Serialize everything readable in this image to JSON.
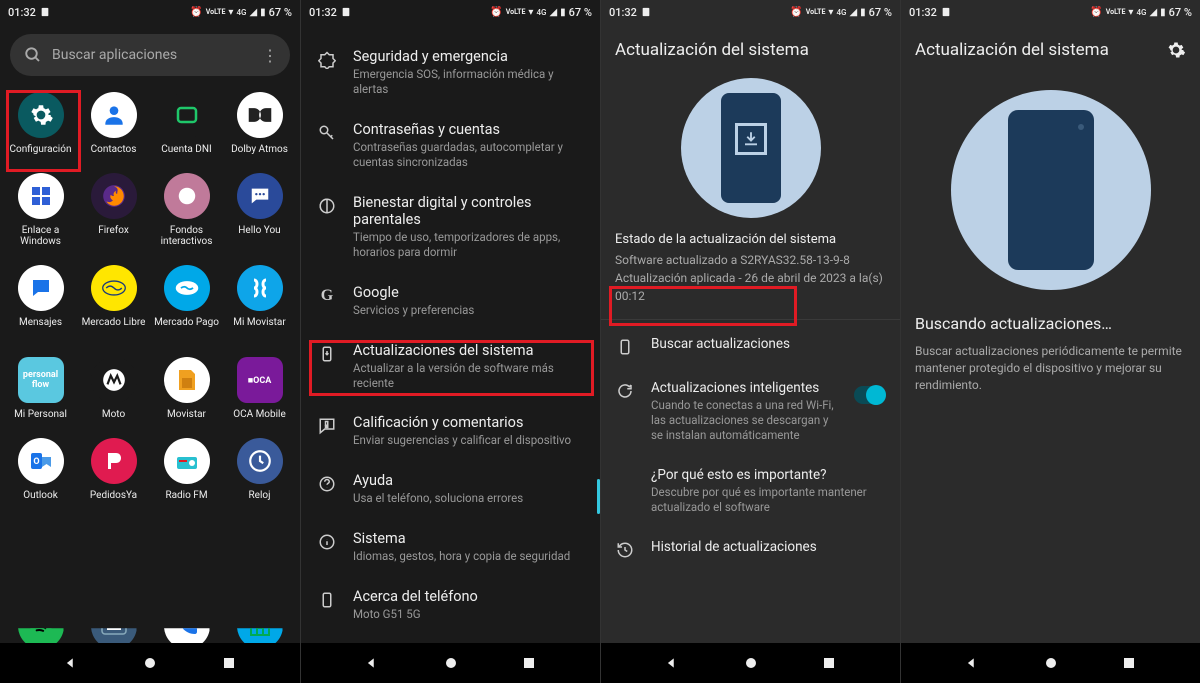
{
  "status": {
    "time": "01:32",
    "battery": "67 %"
  },
  "panel1": {
    "search_placeholder": "Buscar aplicaciones",
    "apps": [
      {
        "label": "Configuración",
        "bg": "#0a5a60",
        "fg": "#fff",
        "glyph": "gear"
      },
      {
        "label": "Contactos",
        "bg": "#ffffff",
        "fg": "#1a73e8",
        "glyph": "person"
      },
      {
        "label": "Cuenta DNI",
        "bg": "#1a1a1a",
        "fg": "#1fc76a",
        "glyph": "dni"
      },
      {
        "label": "Dolby Atmos",
        "bg": "#ffffff",
        "fg": "#222",
        "glyph": "dolby"
      },
      {
        "label": "Enlace a Windows",
        "bg": "#ffffff",
        "fg": "#2e5fd6",
        "glyph": "win",
        "two": true
      },
      {
        "label": "Firefox",
        "bg": "#2a1a3a",
        "fg": "#ff8a00",
        "glyph": "firefox"
      },
      {
        "label": "Fondos interactivos",
        "bg": "#c07a9a",
        "fg": "#fff",
        "glyph": "wall",
        "two": true
      },
      {
        "label": "Hello You",
        "bg": "#2a4a9a",
        "fg": "#fff",
        "glyph": "chat"
      },
      {
        "label": "Mensajes",
        "bg": "#ffffff",
        "fg": "#1a73e8",
        "glyph": "msg"
      },
      {
        "label": "Mercado Libre",
        "bg": "#ffe600",
        "fg": "#1a3a7a",
        "glyph": "ml",
        "two": true
      },
      {
        "label": "Mercado Pago",
        "bg": "#00a8e8",
        "fg": "#fff",
        "glyph": "mp",
        "two": true
      },
      {
        "label": "Mi Movistar",
        "bg": "#0ea5e9",
        "fg": "#fff",
        "glyph": "movi"
      },
      {
        "label": "Mi Personal",
        "bg": "#5ac8e0",
        "fg": "#fff",
        "glyph": "pers",
        "sq": true
      },
      {
        "label": "Moto",
        "bg": "#1a1a1a",
        "fg": "#fff",
        "glyph": "moto"
      },
      {
        "label": "Movistar",
        "bg": "#ffffff",
        "fg": "#0ea5e9",
        "glyph": "sim"
      },
      {
        "label": "OCA Mobile",
        "bg": "#7a1a9a",
        "fg": "#fff",
        "glyph": "oca",
        "sq": true
      },
      {
        "label": "Outlook",
        "bg": "#ffffff",
        "fg": "#1a73e8",
        "glyph": "out"
      },
      {
        "label": "PedidosYa",
        "bg": "#e01b50",
        "fg": "#fff",
        "glyph": "py"
      },
      {
        "label": "Radio FM",
        "bg": "#ffffff",
        "fg": "#e01b24",
        "glyph": "radio"
      },
      {
        "label": "Reloj",
        "bg": "#3a5a9a",
        "fg": "#fff",
        "glyph": "clock"
      }
    ],
    "bottom_apps": [
      {
        "bg": "#1db954",
        "glyph": "spotify"
      },
      {
        "bg": "#3a5a7a",
        "glyph": "kbd"
      },
      {
        "bg": "#ffffff",
        "glyph": "phone",
        "fg": "#1a73e8"
      },
      {
        "bg": "#00a8e8",
        "glyph": "home"
      }
    ]
  },
  "panel2": {
    "items": [
      {
        "icon": "medical",
        "title": "Seguridad y emergencia",
        "sub": "Emergencia SOS, información médica y alertas"
      },
      {
        "icon": "key",
        "title": "Contraseñas y cuentas",
        "sub": "Contraseñas guardadas, autocompletar y cuentas sincronizadas"
      },
      {
        "icon": "wellbeing",
        "title": "Bienestar digital y controles parentales",
        "sub": "Tiempo de uso, temporizadores de apps, horarios para dormir"
      },
      {
        "icon": "google",
        "title": "Google",
        "sub": "Servicios y preferencias"
      },
      {
        "icon": "phone-update",
        "title": "Actualizaciones del sistema",
        "sub": "Actualizar a la versión de software más reciente"
      },
      {
        "icon": "feedback",
        "title": "Calificación y comentarios",
        "sub": "Enviar sugerencias y calificar el dispositivo"
      },
      {
        "icon": "help",
        "title": "Ayuda",
        "sub": "Usa el teléfono, soluciona errores"
      },
      {
        "icon": "info",
        "title": "Sistema",
        "sub": "Idiomas, gestos, hora y copia de seguridad"
      },
      {
        "icon": "about",
        "title": "Acerca del teléfono",
        "sub": "Moto G51 5G"
      }
    ]
  },
  "panel3": {
    "header": "Actualización del sistema",
    "status_title": "Estado de la actualización del sistema",
    "status_line1": "Software actualizado a S2RYAS32.58-13-9-8",
    "status_line2": "Actualización aplicada - 26 de abril de 2023 a la(s) 00:12",
    "items": [
      {
        "icon": "check-update",
        "title": "Buscar actualizaciones",
        "sub": ""
      },
      {
        "icon": "refresh",
        "title": "Actualizaciones inteligentes",
        "sub": "Cuando te conectas a una red Wi-Fi, las actualizaciones se descargan y se instalan automáticamente",
        "toggle": true
      },
      {
        "icon": "",
        "title": "¿Por qué esto es importante?",
        "sub": "Descubre por qué es importante mantener actualizado el software"
      },
      {
        "icon": "history",
        "title": "Historial de actualizaciones",
        "sub": ""
      }
    ]
  },
  "panel4": {
    "header": "Actualización del sistema",
    "searching_title": "Buscando actualizaciones…",
    "searching_desc": "Buscar actualizaciones periódicamente te permite mantener protegido el dispositivo y mejorar su rendimiento."
  }
}
